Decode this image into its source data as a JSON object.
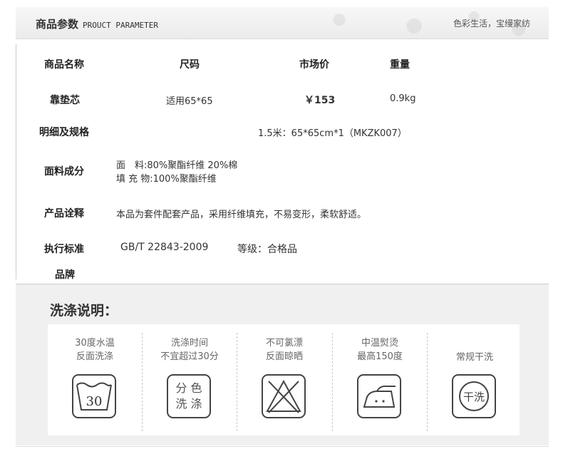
{
  "header": {
    "title": "商品参数",
    "title_en": "PROUCT PARAMETER",
    "slogan": "色彩生活，宝缦家纺"
  },
  "params": {
    "col_name": "商品名称",
    "col_size": "尺码",
    "col_price": "市场价",
    "col_weight": "重量",
    "name": "靠垫芯",
    "size": "适用65*65",
    "price": "￥153",
    "weight": "0.9kg",
    "spec_label": "明细及规格",
    "spec_value": "1.5米：65*65cm*1（MKZK007）",
    "fabric_label": "面料成分",
    "fabric_line1": "面　料:80%聚酯纤维 20%棉",
    "fabric_line2": "填 充 物:100%聚酯纤维",
    "desc_label": "产品诠释",
    "desc_value": "本品为套件配套产品，采用纤维填充，不易变形，柔软舒适。",
    "standard_label": "执行标准",
    "standard_value": "GB/T 22843-2009",
    "grade_value": "等级：合格品",
    "brand_label": "品牌"
  },
  "washing": {
    "title": "洗涤说明：",
    "items": [
      {
        "line1": "30度水温",
        "line2": "反面洗涤",
        "icon": "wash-30-icon",
        "symbol": "30"
      },
      {
        "line1": "洗涤时间",
        "line2": "不宜超过30分",
        "icon": "separate-colors-icon",
        "symbol_line1": "分 色",
        "symbol_line2": "洗 涤"
      },
      {
        "line1": "不可氯漂",
        "line2": "反面晾晒",
        "icon": "no-bleach-icon"
      },
      {
        "line1": "中温熨烫",
        "line2": "最高150度",
        "icon": "iron-medium-icon"
      },
      {
        "line1": "常规干洗",
        "line2": "",
        "icon": "dry-clean-icon",
        "symbol": "干洗"
      }
    ]
  }
}
